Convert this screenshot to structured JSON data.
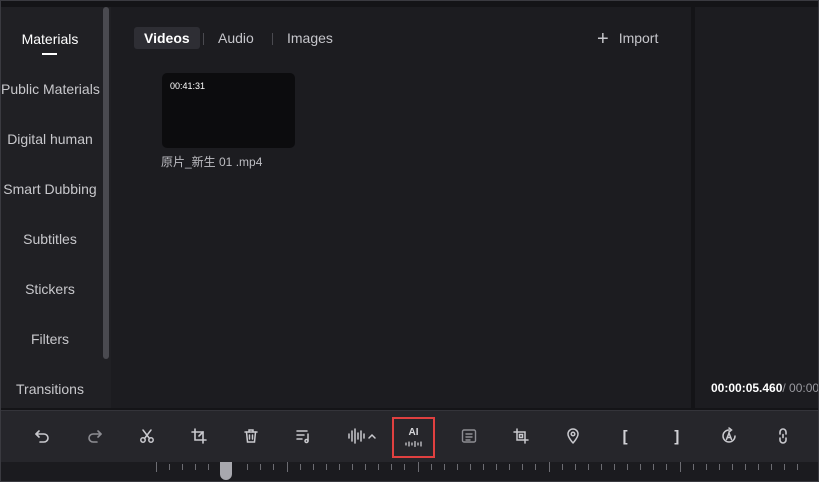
{
  "sidebar": {
    "items": [
      {
        "label": "Materials",
        "active": true
      },
      {
        "label": "Public Materials"
      },
      {
        "label": "Digital human"
      },
      {
        "label": "Smart Dubbing"
      },
      {
        "label": "Subtitles"
      },
      {
        "label": "Stickers"
      },
      {
        "label": "Filters"
      },
      {
        "label": "Transitions"
      }
    ]
  },
  "materials": {
    "tabs": [
      {
        "label": "Videos",
        "active": true
      },
      {
        "label": "Audio"
      },
      {
        "label": "Images"
      }
    ],
    "import_label": "Import",
    "clips": [
      {
        "duration": "00:41:31",
        "name": "原片_新生 01 .mp4"
      }
    ]
  },
  "preview": {
    "current_time": "00:00:05.460",
    "total_time": "/ 00:00"
  },
  "toolbar": {
    "ai_label": "AI",
    "left_bracket": "[",
    "right_bracket": "]",
    "icons": [
      "undo-icon",
      "redo-icon",
      "scissors-icon",
      "crop-trim-icon",
      "delete-icon",
      "music-list-icon",
      "audio-wave-icon",
      "ai-audio-icon",
      "subtitle-recognize-icon",
      "crop-icon",
      "location-pin-icon",
      "mark-in-icon",
      "mark-out-icon",
      "auto-reframe-icon",
      "link-icon"
    ]
  },
  "colors": {
    "ai_highlight_border": "#e04040",
    "panel_bg": "#1c1c20",
    "sidebar_bg": "#202024"
  }
}
